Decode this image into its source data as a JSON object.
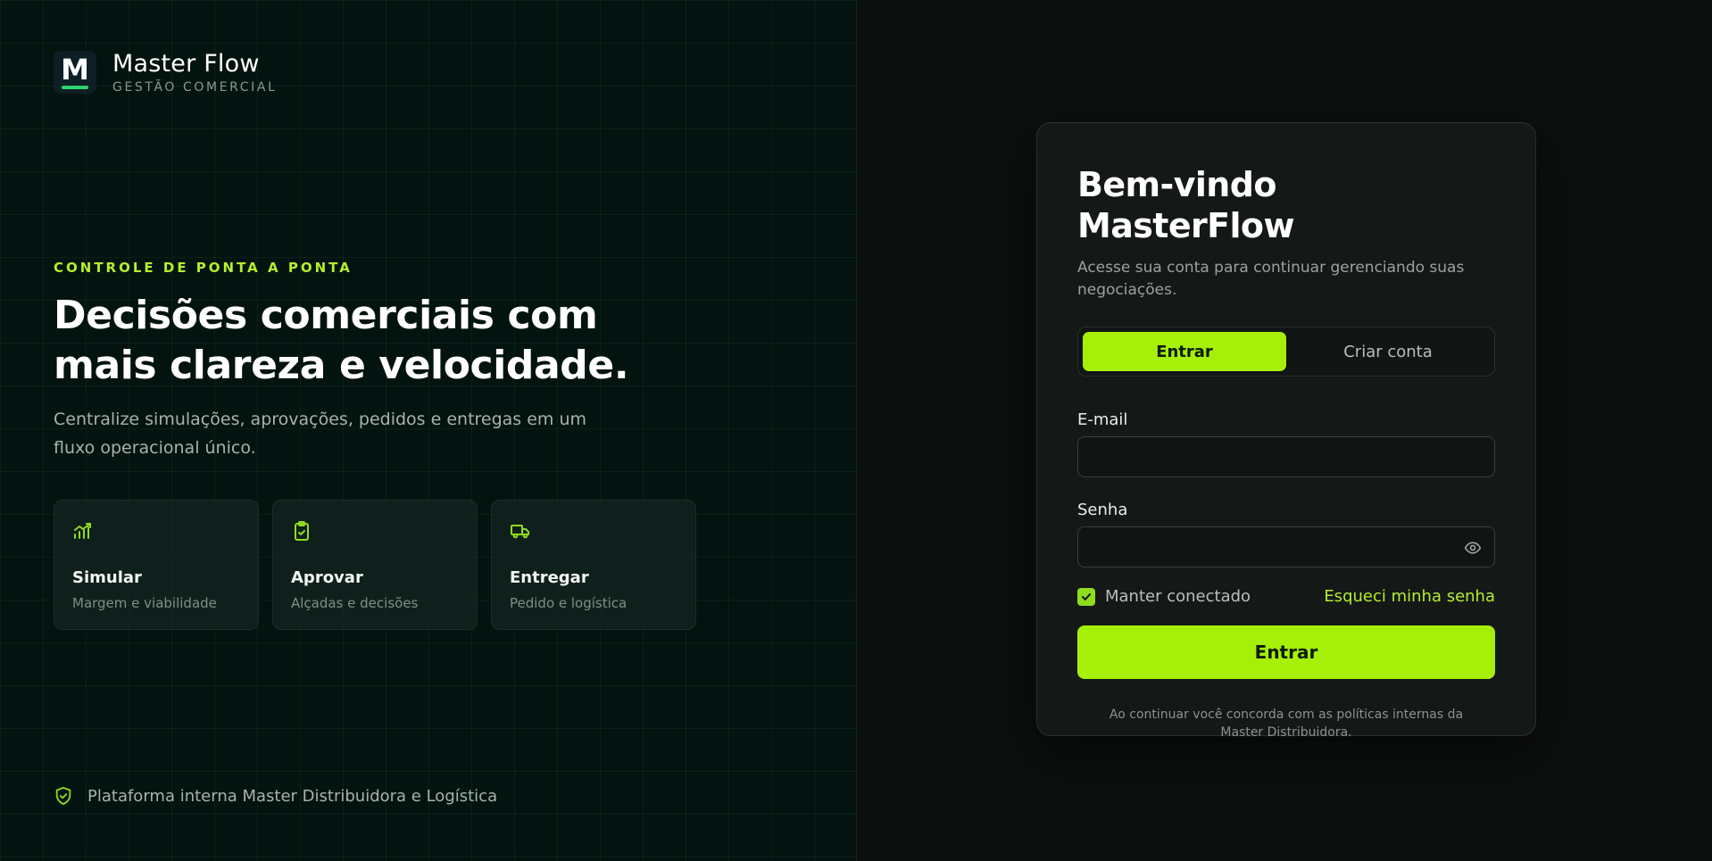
{
  "brand": {
    "logo_letter": "M",
    "name": "Master Flow",
    "tagline": "GESTÃO COMERCIAL"
  },
  "hero": {
    "eyebrow": "CONTROLE DE PONTA A PONTA",
    "headline": "Decisões comerciais com mais clareza e velocidade.",
    "subtext": "Centralize simulações, aprovações, pedidos e entregas em um fluxo operacional único."
  },
  "features": [
    {
      "icon": "chart-trend-icon",
      "title": "Simular",
      "desc": "Margem e viabilidade"
    },
    {
      "icon": "clipboard-check-icon",
      "title": "Aprovar",
      "desc": "Alçadas e decisões"
    },
    {
      "icon": "truck-icon",
      "title": "Entregar",
      "desc": "Pedido e logística"
    }
  ],
  "footer": {
    "icon": "shield-check-icon",
    "text": "Plataforma interna Master Distribuidora e Logística"
  },
  "login": {
    "title": "Bem-vindo MasterFlow",
    "subtitle": "Acesse sua conta para continuar gerenciando suas negociações.",
    "tabs": [
      {
        "label": "Entrar",
        "active": true
      },
      {
        "label": "Criar conta",
        "active": false
      }
    ],
    "email_label": "E-mail",
    "email_value": "",
    "password_label": "Senha",
    "password_value": "",
    "password_toggle_icon": "eye-icon",
    "remember_label": "Manter conectado",
    "remember_checked": true,
    "forgot_label": "Esqueci minha senha",
    "submit_label": "Entrar",
    "terms": "Ao continuar você concorda com as políticas internas da Master Distribuidora."
  },
  "colors": {
    "accent": "#a6ef08",
    "accent_text": "#b4f02c",
    "left_bg": "#03130f",
    "right_bg": "#0c0f0e",
    "card_bg": "#141816",
    "icon_green": "#8fdc1e"
  }
}
